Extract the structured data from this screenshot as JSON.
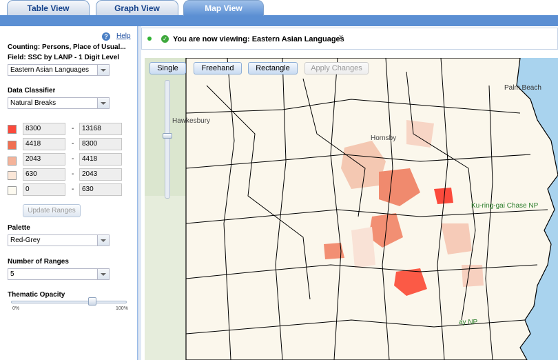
{
  "tabs": {
    "table": "Table View",
    "graph": "Graph View",
    "map": "Map View"
  },
  "left": {
    "help": "Help",
    "counting": "Counting: Persons, Place of Usual...",
    "field": "Field: SSC by LANP - 1 Digit Level",
    "field_select": "Eastern Asian Languages",
    "classifier_label": "Data Classifier",
    "classifier_select": "Natural Breaks",
    "ranges": [
      {
        "from": "8300",
        "to": "13168",
        "color": "#fb4a3c"
      },
      {
        "from": "4418",
        "to": "8300",
        "color": "#f06f52"
      },
      {
        "from": "2043",
        "to": "4418",
        "color": "#f4b39a"
      },
      {
        "from": "630",
        "to": "2043",
        "color": "#fbe7d8"
      },
      {
        "from": "0",
        "to": "630",
        "color": "#fdfaf0"
      }
    ],
    "range_dash": "-",
    "update_button": "Update Ranges",
    "palette_label": "Palette",
    "palette_select": "Red-Grey",
    "num_ranges_label": "Number of Ranges",
    "num_ranges_select": "5",
    "opacity_label": "Thematic Opacity",
    "opacity_min": "0%",
    "opacity_max": "100%",
    "opacity_value": 0.72
  },
  "map": {
    "viewing_text": "You are now viewing: Eastern Asian Languages",
    "close_glyph": "x",
    "buttons": {
      "single": "Single",
      "freehand": "Freehand",
      "rectangle": "Rectangle",
      "apply": "Apply Changes"
    },
    "labels": {
      "palm_beach": "Palm Beach",
      "hornsby": "Hornsby",
      "np_north": "Ku-ring-gai Chase NP",
      "np_south": "ay NP",
      "hawkesbury": "Hawkesbury"
    }
  }
}
